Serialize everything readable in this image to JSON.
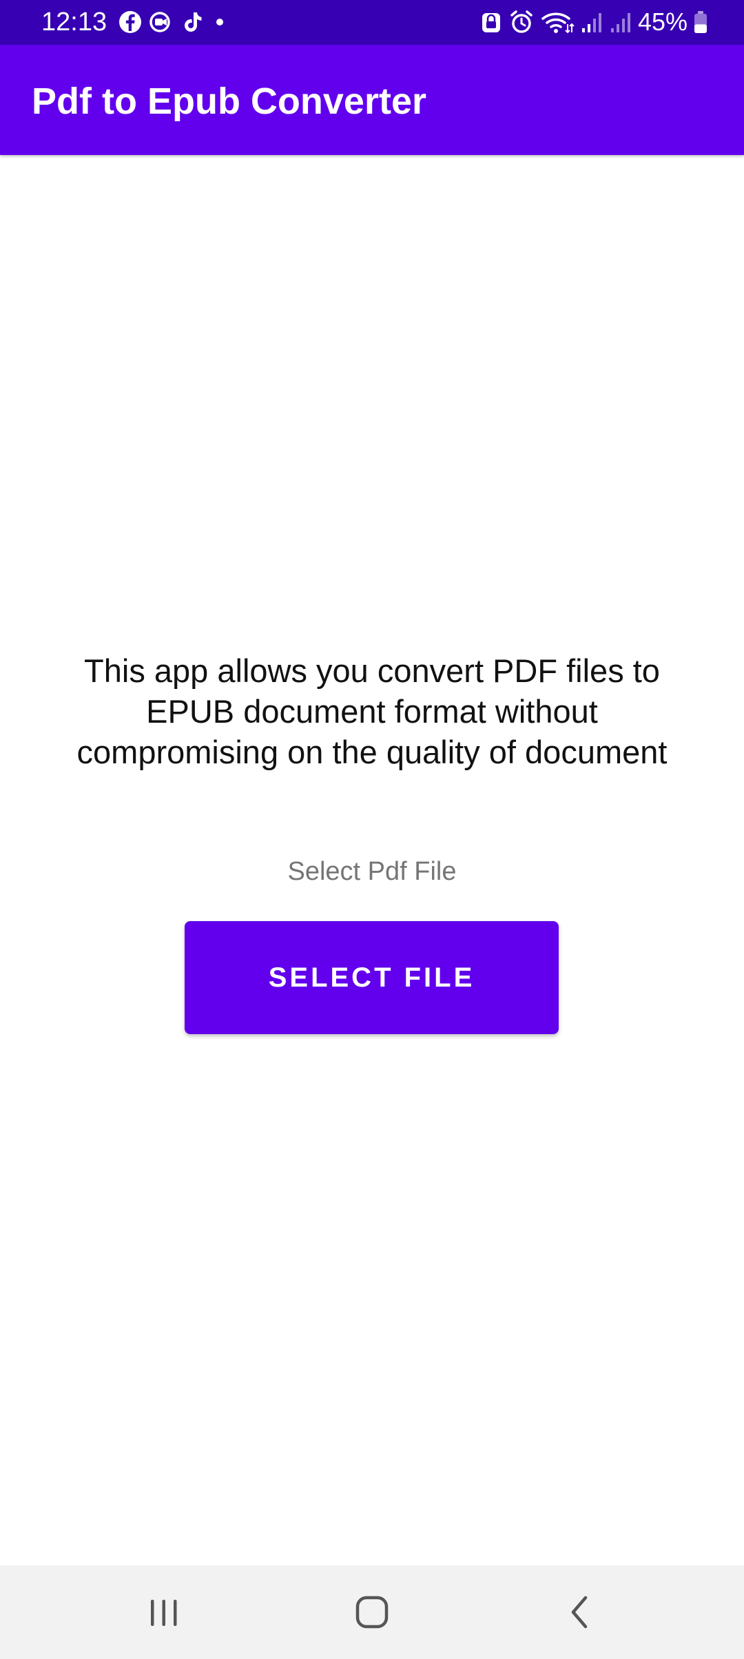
{
  "status_bar": {
    "time": "12:13",
    "battery_percent": "45%",
    "battery_level": 0.45,
    "left_icons": [
      "facebook-icon",
      "messenger-video-icon",
      "tiktok-icon",
      "notification-dot-icon"
    ],
    "right_icons": [
      "vpn-lock-icon",
      "alarm-icon",
      "wifi-icon",
      "signal-icon",
      "signal-icon",
      "battery-icon"
    ]
  },
  "app_bar": {
    "title": "Pdf to Epub Converter"
  },
  "main": {
    "description": "This app allows you convert PDF files to EPUB document format without compromising on the quality of document",
    "select_label": "Select Pdf File",
    "select_button": "SELECT FILE"
  },
  "nav_bar": {
    "buttons": [
      "recents-icon",
      "home-icon",
      "back-icon"
    ]
  },
  "colors": {
    "status_bar": "#3700b3",
    "primary": "#6200ee",
    "text_primary": "#111111",
    "text_secondary": "#757575",
    "nav_background": "#f2f2f2"
  }
}
